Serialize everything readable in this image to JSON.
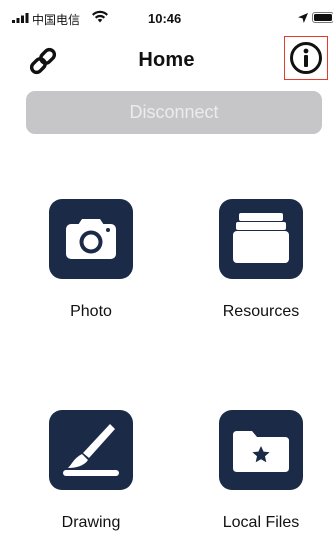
{
  "status_bar": {
    "carrier": "中国电信",
    "time": "10:46"
  },
  "nav": {
    "title": "Home",
    "left_icon": "link-icon",
    "right_icon": "info-icon"
  },
  "disconnect_label": "Disconnect",
  "tiles": [
    {
      "label": "Photo",
      "icon": "camera-icon"
    },
    {
      "label": "Resources",
      "icon": "folder-stack-icon"
    },
    {
      "label": "Drawing",
      "icon": "brush-icon"
    },
    {
      "label": "Local Files",
      "icon": "folder-star-icon"
    }
  ],
  "colors": {
    "tile_bg": "#1b2a47",
    "disabled_button": "#c6c6c8",
    "highlight": "#e33b2e"
  }
}
